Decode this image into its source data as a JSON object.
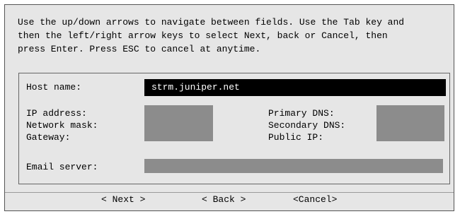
{
  "instructions": "Use the up/down arrows to navigate between fields. Use the Tab key and\nthen the left/right arrow keys to select Next, back or Cancel, then\npress Enter. Press ESC to cancel at anytime.",
  "form": {
    "host_name": {
      "label": "Host name:",
      "value": "strm.juniper.net"
    },
    "ip_address": {
      "label": "IP address:",
      "value": ""
    },
    "network_mask": {
      "label": "Network mask:",
      "value": ""
    },
    "gateway": {
      "label": "Gateway:",
      "value": ""
    },
    "primary_dns": {
      "label": "Primary DNS:",
      "value": ""
    },
    "secondary_dns": {
      "label": "Secondary DNS:",
      "value": ""
    },
    "public_ip": {
      "label": "Public IP:",
      "value": ""
    },
    "email_server": {
      "label": "Email server:",
      "value": ""
    }
  },
  "buttons": {
    "next": "< Next >",
    "back": "< Back >",
    "cancel": "<Cancel>"
  },
  "colors": {
    "dialog_bg": "#e6e6e6",
    "field_bg": "#8c8c8c",
    "active_field_bg": "#000000",
    "active_field_text": "#ffffff"
  }
}
